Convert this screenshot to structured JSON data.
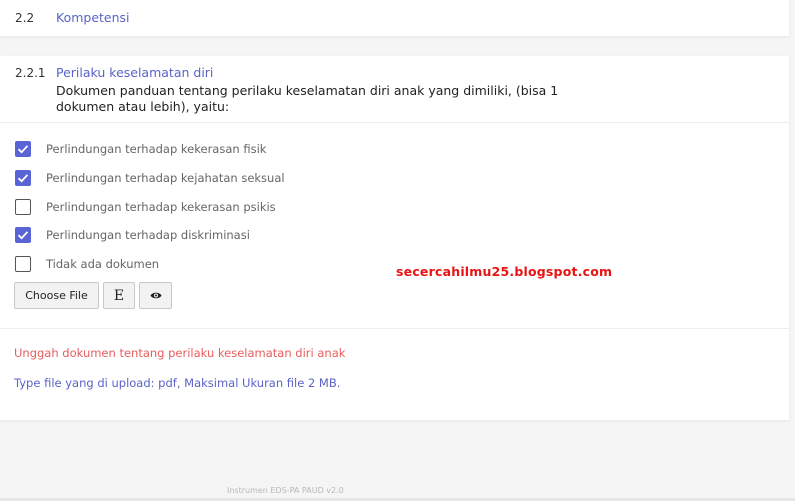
{
  "section": {
    "number": "2.2",
    "title": "Kompetensi"
  },
  "question": {
    "number": "2.2.1",
    "title": "Perilaku keselamatan diri",
    "description": "Dokumen panduan tentang perilaku keselamatan diri anak yang dimiliki, (bisa 1 dokumen atau lebih), yaitu:"
  },
  "options": [
    {
      "label": "Perlindungan terhadap kekerasan fisik",
      "checked": true
    },
    {
      "label": "Perlindungan terhadap kejahatan seksual",
      "checked": true
    },
    {
      "label": "Perlindungan terhadap kekerasan psikis",
      "checked": false
    },
    {
      "label": "Perlindungan terhadap diskriminasi",
      "checked": true
    },
    {
      "label": "Tidak ada dokumen",
      "checked": false
    }
  ],
  "buttons": {
    "choose_file": "Choose File",
    "e_label": "E",
    "preview_icon": "eye-icon"
  },
  "watermark": "secercahilmu25.blogspot.com",
  "notes": {
    "upload_hint": "Unggah dokumen tentang perilaku keselamatan diri anak",
    "file_type": "Type file yang di upload: pdf, Maksimal Ukuran file 2 MB."
  },
  "footer": "Instrumen EDS-PA PAUD v2.0",
  "colors": {
    "accent": "#5b64d6",
    "title": "#5a63c9",
    "warning": "#e85d5d",
    "watermark": "#e81313"
  }
}
